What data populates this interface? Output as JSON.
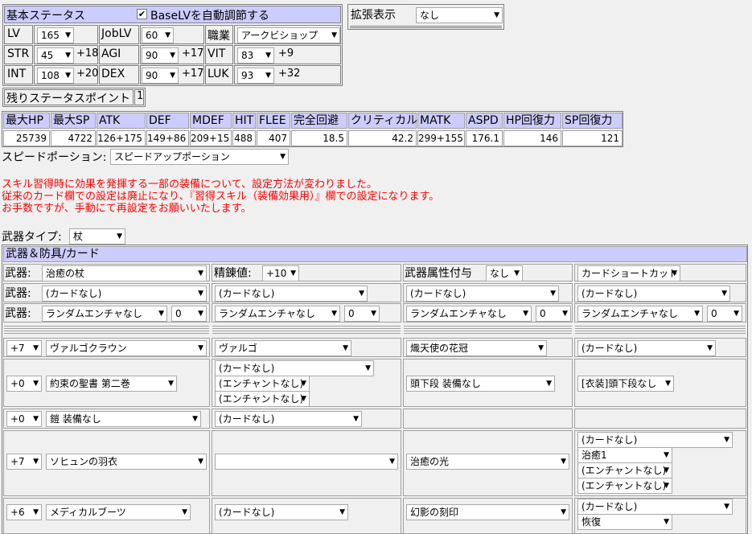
{
  "status": {
    "title": "基本ステータス",
    "auto_base_label": "BaseLVを自動調節する",
    "lv_label": "LV",
    "lv": "165",
    "joblv_label": "JobLV",
    "joblv": "60",
    "job_label": "職業",
    "job": "アークビショップ",
    "stats": [
      {
        "name": "STR",
        "value": "45",
        "bonus": "+18"
      },
      {
        "name": "AGI",
        "value": "90",
        "bonus": "+17"
      },
      {
        "name": "VIT",
        "value": "83",
        "bonus": "+9"
      },
      {
        "name": "INT",
        "value": "108",
        "bonus": "+20"
      },
      {
        "name": "DEX",
        "value": "90",
        "bonus": "+17"
      },
      {
        "name": "LUK",
        "value": "93",
        "bonus": "+32"
      }
    ],
    "remaining_label": "残りステータスポイント",
    "remaining": "1"
  },
  "ext": {
    "title": "拡張表示",
    "value": "なし"
  },
  "battle": {
    "headers": [
      "最大HP",
      "最大SP",
      "ATK",
      "DEF",
      "MDEF",
      "HIT",
      "FLEE",
      "完全回避",
      "クリティカル",
      "MATK",
      "ASPD",
      "HP回復力",
      "SP回復力"
    ],
    "values": [
      "25739",
      "4722",
      "126+175",
      "149+86",
      "209+15",
      "488",
      "407",
      "18.5",
      "42.2",
      "299+155",
      "176.1",
      "146",
      "121"
    ]
  },
  "speed": {
    "label": "スピードポーション:",
    "value": "スピードアップポーション"
  },
  "notice": [
    "スキル習得時に効果を発揮する一部の装備について、設定方法が変わりました。",
    "従来のカード欄での設定は廃止になり、『習得スキル（装備効果用）』欄での設定になります。",
    "お手数ですが、手動にて再設定をお願いいたします。"
  ],
  "weapon_type": {
    "label": "武器タイプ:",
    "value": "杖"
  },
  "equip": {
    "title": "武器＆防具/カード",
    "weapon_label": "武器:",
    "weapon": "治癒の杖",
    "refine_label": "精錬値:",
    "refine": "+10",
    "element_label": "武器属性付与",
    "element": "なし",
    "shortcut": "カードショートカット",
    "card_none": "(カードなし)",
    "random_enchant": "ランダムエンチャなし",
    "zero": "0",
    "enchant_none": "(エンチャントなし)",
    "head": {
      "refine": "+7",
      "item": "ヴァルゴクラウン",
      "card": "ヴァルゴ",
      "enchant": "熾天使の花冠",
      "slot4": "(カードなし)"
    },
    "offhand": {
      "refine": "+0",
      "item": "約束の聖書 第二巻",
      "mid": "頭下段 装備なし",
      "costume": "[衣装]頭下段なし"
    },
    "armor": {
      "refine": "+0",
      "item": "鎧 装備なし"
    },
    "garment": {
      "refine": "+7",
      "item": "ソヒュンの羽衣",
      "enchant": "治癒の光",
      "opt1": "治癒1"
    },
    "shoes": {
      "refine": "+6",
      "item": "メディカルブーツ",
      "enchant": "幻影の刻印",
      "opt1": "恢復"
    }
  }
}
